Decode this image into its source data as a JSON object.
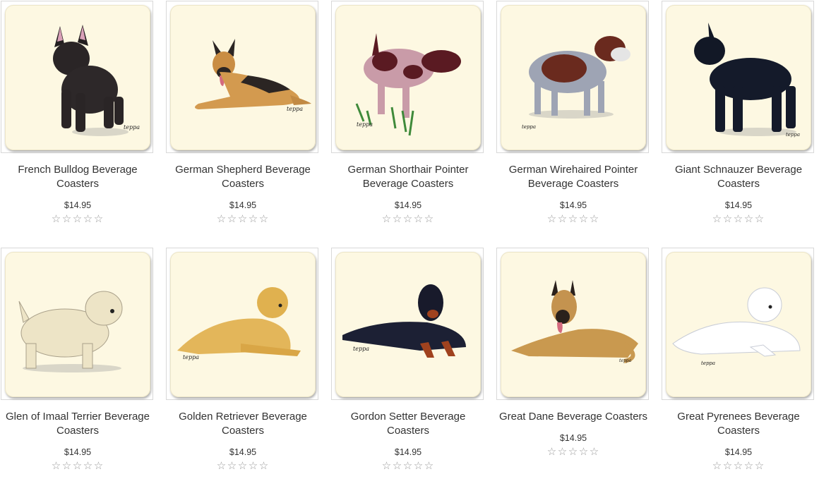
{
  "products": [
    {
      "name": "French Bulldog Beverage Coasters",
      "price": "$14.95",
      "rating": 0,
      "icon": "french-bulldog-illustration"
    },
    {
      "name": "German Shepherd Beverage Coasters",
      "price": "$14.95",
      "rating": 0,
      "icon": "german-shepherd-illustration"
    },
    {
      "name": "German Shorthair Pointer Beverage Coasters",
      "price": "$14.95",
      "rating": 0,
      "icon": "german-shorthair-pointer-illustration"
    },
    {
      "name": "German Wirehaired Pointer Beverage Coasters",
      "price": "$14.95",
      "rating": 0,
      "icon": "german-wirehaired-pointer-illustration"
    },
    {
      "name": "Giant Schnauzer Beverage Coasters",
      "price": "$14.95",
      "rating": 0,
      "icon": "giant-schnauzer-illustration"
    },
    {
      "name": "Glen of Imaal Terrier Beverage Coasters",
      "price": "$14.95",
      "rating": 0,
      "icon": "glen-of-imaal-terrier-illustration"
    },
    {
      "name": "Golden Retriever Beverage Coasters",
      "price": "$14.95",
      "rating": 0,
      "icon": "golden-retriever-illustration"
    },
    {
      "name": "Gordon Setter Beverage Coasters",
      "price": "$14.95",
      "rating": 0,
      "icon": "gordon-setter-illustration"
    },
    {
      "name": "Great Dane Beverage Coasters",
      "price": "$14.95",
      "rating": 0,
      "icon": "great-dane-illustration"
    },
    {
      "name": "Great Pyrenees Beverage Coasters",
      "price": "$14.95",
      "rating": 0,
      "icon": "great-pyrenees-illustration"
    }
  ],
  "colors": {
    "coaster_background": "#fdf8e2",
    "text": "#333333",
    "star_empty": "#9a9a9a"
  },
  "star_icon": "star-outline-icon",
  "star_max": 5
}
